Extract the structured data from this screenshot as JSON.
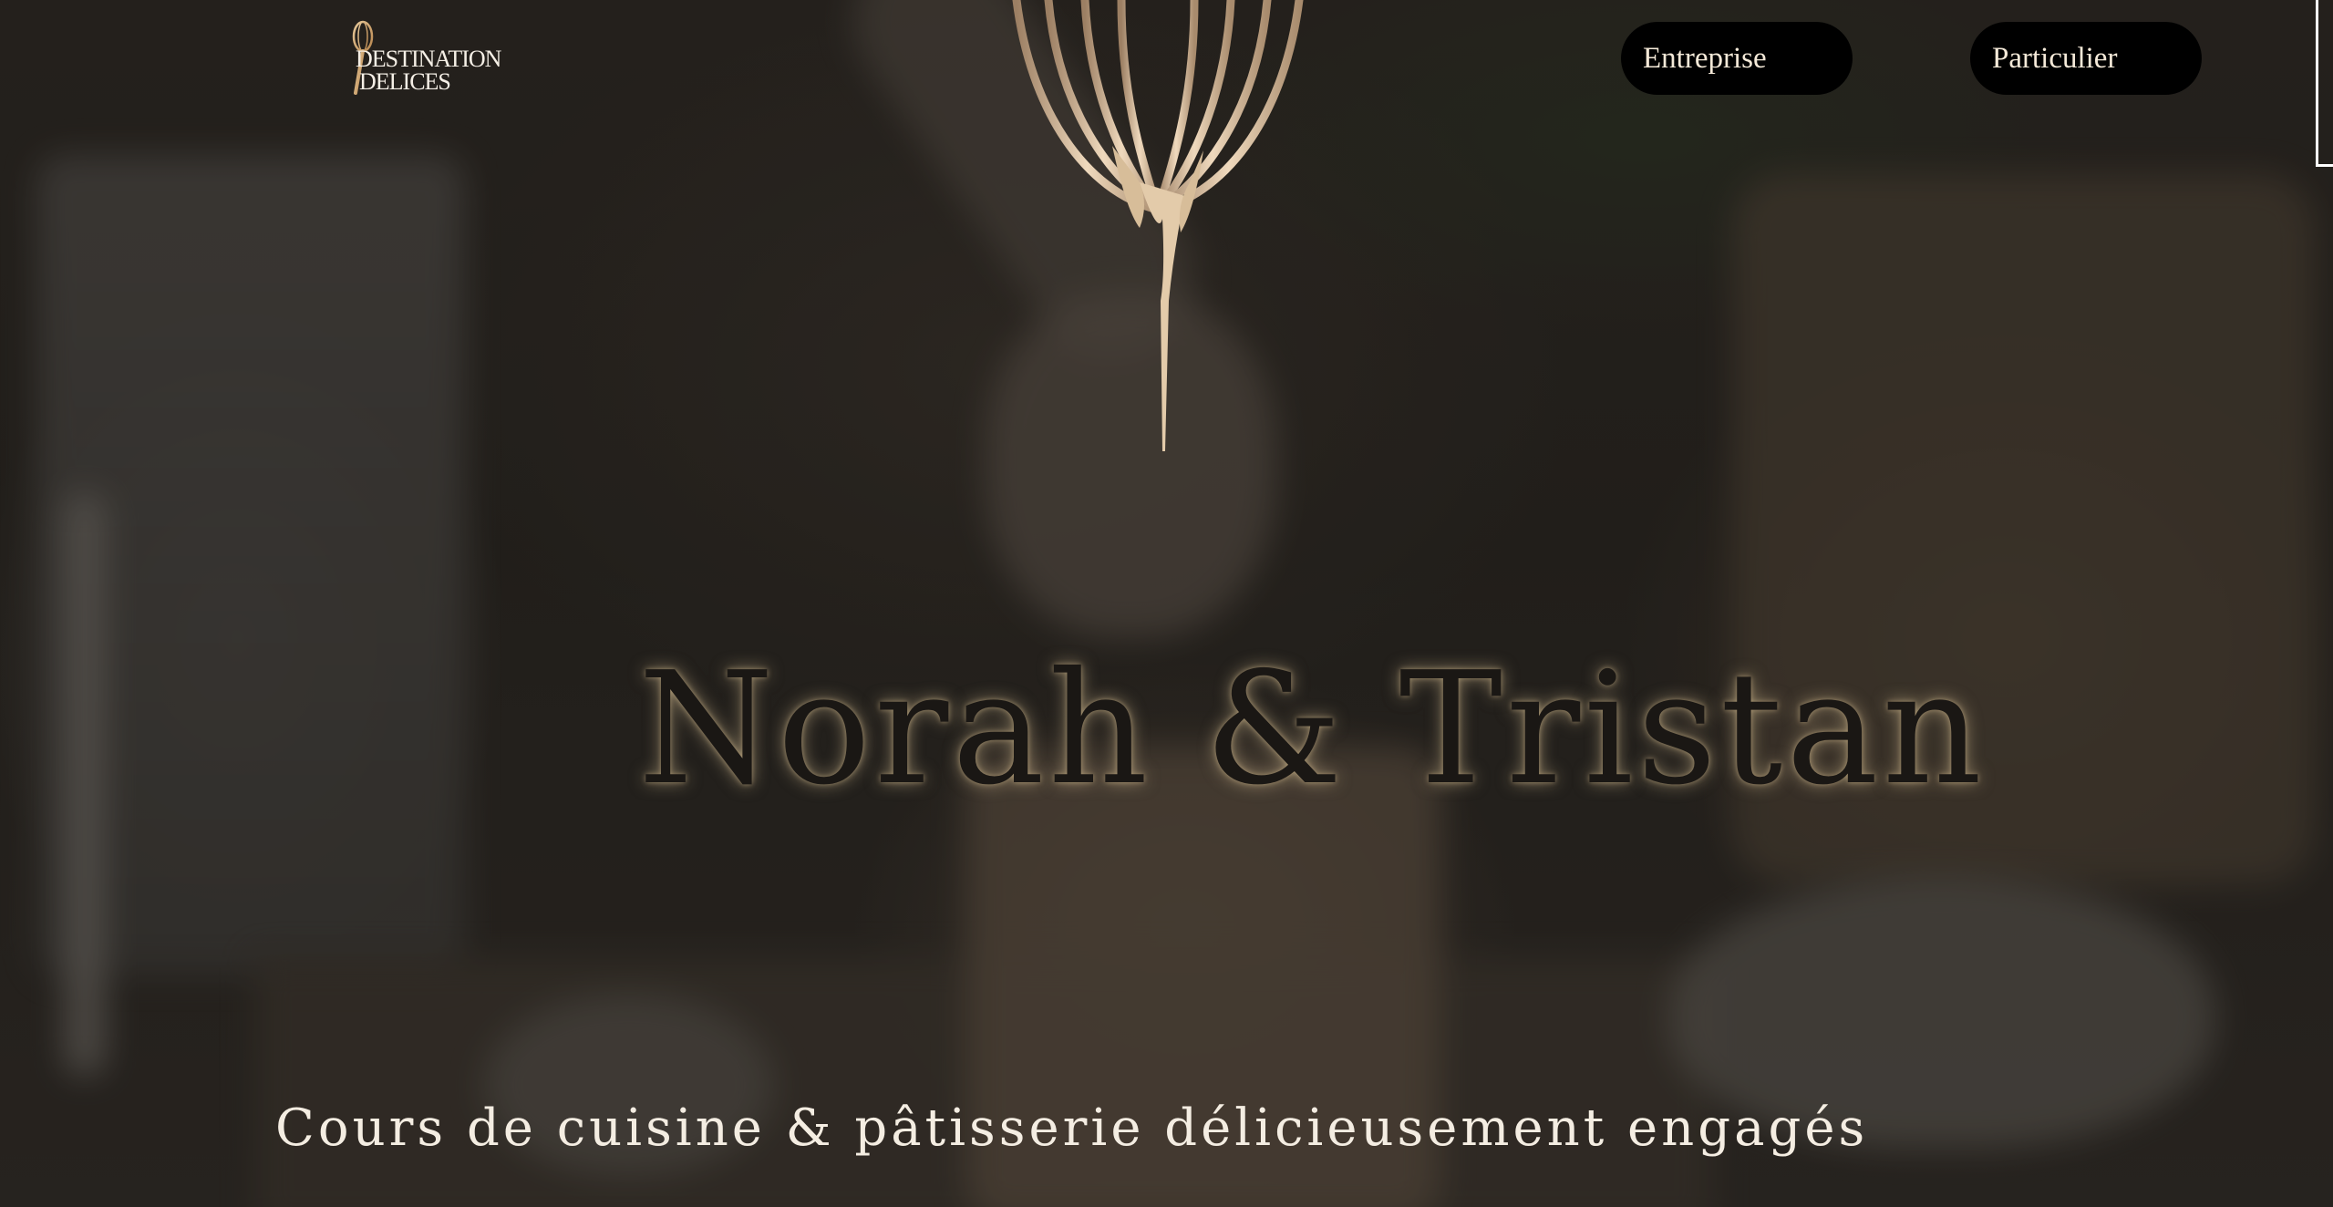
{
  "header": {
    "logo": {
      "line1": "DESTINATION",
      "line2": "DELICES",
      "icon": "whisk-icon"
    },
    "nav": [
      {
        "label": "Entreprise"
      },
      {
        "label": "Particulier"
      }
    ]
  },
  "hero": {
    "title": "Norah & Tristan",
    "subtitle": "Cours de cuisine & pâtisserie délicieusement engagés",
    "decoration": "whisk-dripping-icon"
  },
  "colors": {
    "button_bg": "#000000",
    "button_text": "#f4e9d8",
    "subtitle_text": "#f4ede2",
    "title_glow": "#e6cda0",
    "whisk": "#d9bfa0"
  }
}
